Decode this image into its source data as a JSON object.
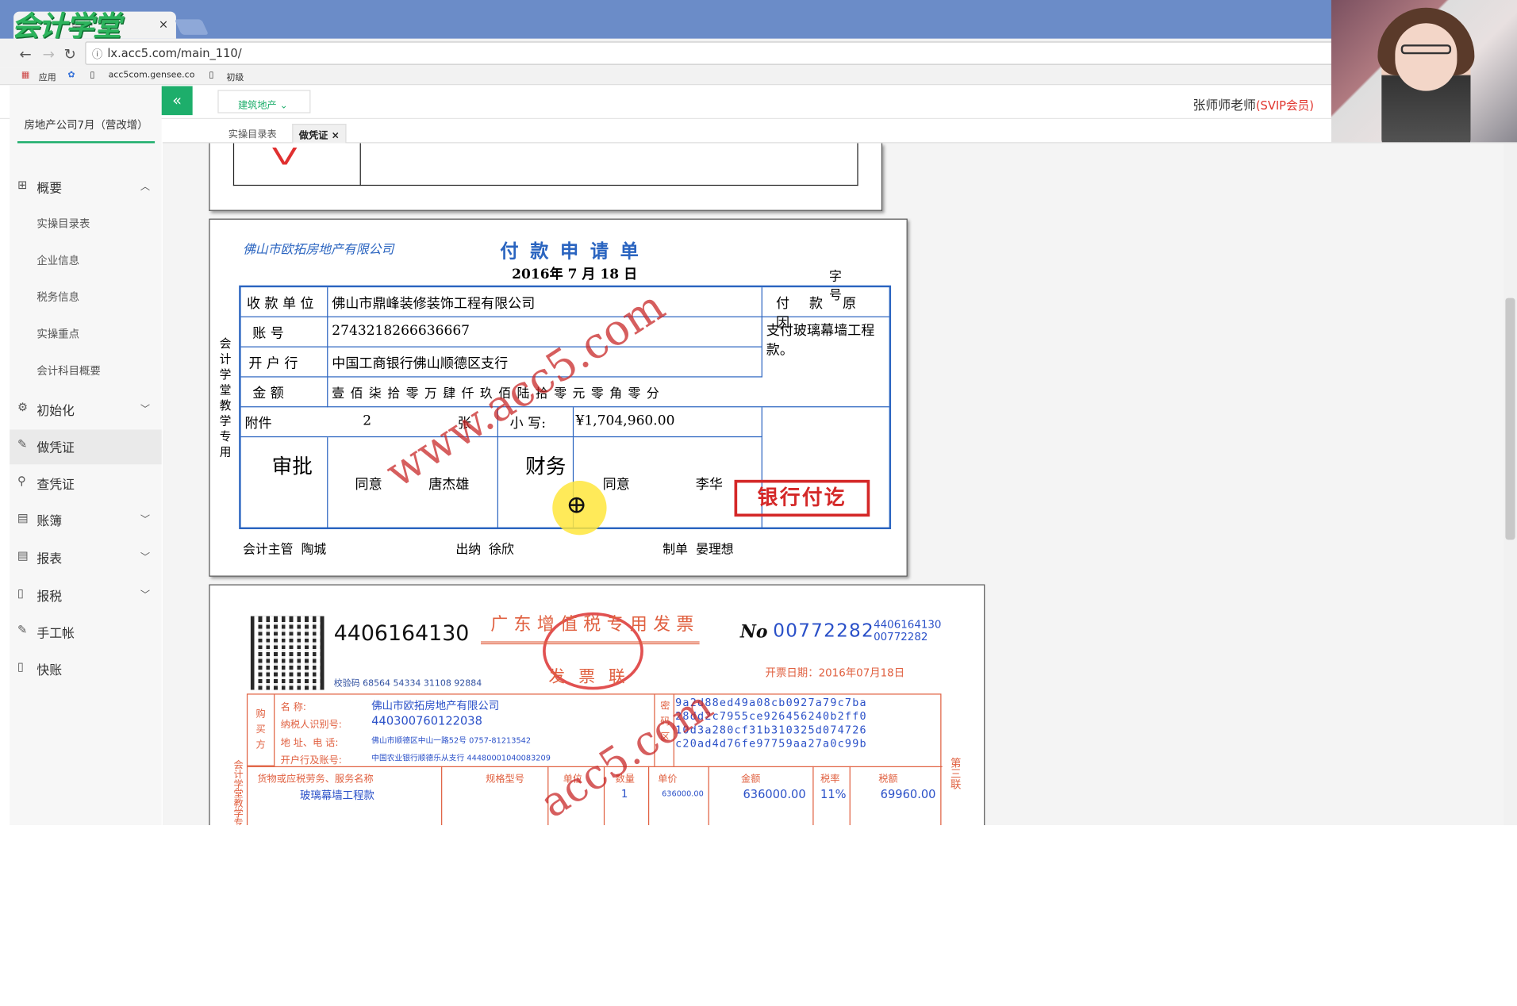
{
  "browser": {
    "tab_title": "会计 ×",
    "tab_title_short": "会计",
    "url": "lx.acc5.com/main_110/",
    "bookmarks": [
      "应用",
      "acc5com.gensee.co",
      "初级"
    ],
    "logo": "会计学堂"
  },
  "header": {
    "dropdown": "建筑地产",
    "user_name": "张师师老师",
    "user_badge": "(SVIP会员)",
    "tabs": [
      "实操目录表",
      "做凭证"
    ]
  },
  "sidebar": {
    "company": "房地产公司7月（营改增）",
    "sections": [
      {
        "label": "概要",
        "icon": "grid-icon",
        "expanded": true,
        "items": [
          "实操目录表",
          "企业信息",
          "税务信息",
          "实操重点",
          "会计科目概要"
        ]
      },
      {
        "label": "初始化",
        "icon": "gear-icon"
      },
      {
        "label": "做凭证",
        "icon": "pen-icon",
        "active": true
      },
      {
        "label": "查凭证",
        "icon": "search-icon"
      },
      {
        "label": "账簿",
        "icon": "book-icon"
      },
      {
        "label": "报表",
        "icon": "report-icon"
      },
      {
        "label": "报税",
        "icon": "file-icon"
      },
      {
        "label": "手工帐",
        "icon": "pen-icon"
      },
      {
        "label": "快账",
        "icon": "file-icon"
      }
    ]
  },
  "payment": {
    "company": "佛山市欧拓房地产有限公司",
    "title": "付款申请单",
    "date": "2016年 7 月 18 日",
    "number_label": "字 号",
    "side_text": "会计学堂教学专用",
    "payee_label": "收 款 单 位",
    "payee": "佛山市鼎峰装修装饰工程有限公司",
    "account_label": "账 号",
    "account": "2743218266636667",
    "bank_label": "开 户 行",
    "bank": "中国工商银行佛山顺德区支行",
    "amount_label": "金 额",
    "amount_words": "壹 佰 柒 拾 零 万 肆 仟 玖 佰 陆 拾 零 元 零 角 零 分",
    "attach_label": "附件",
    "attach_count": "2",
    "attach_unit": "张",
    "small_label": "小 写:",
    "small_value": "¥1,704,960.00",
    "reason_label": "付 款 原 因",
    "reason": "支付玻璃幕墙工程款。",
    "approve_label": "审批",
    "approve_opinion": "同意",
    "approve_person": "唐杰雄",
    "finance_label": "财务",
    "finance_opinion": "同意",
    "finance_person": "李华",
    "stamp": "银行付讫",
    "supervisor_label": "会计主管",
    "supervisor": "陶城",
    "cashier_label": "出纳",
    "cashier": "徐欣",
    "maker_label": "制单",
    "maker": "晏理想",
    "watermark": "www.acc5.com"
  },
  "invoice": {
    "code": "4406164130",
    "title": "广东增值税专用发票",
    "subtitle": "发票联",
    "no_label": "No",
    "number": "00772282",
    "small_code": "4406164130",
    "small_number": "00772282",
    "check_code": "校验码 68564 54334 31108 92884",
    "date_label": "开票日期：",
    "date": "2016年07月18日",
    "buyer_section": "购买方",
    "name_label": "名 称:",
    "name": "佛山市欧拓房地产有限公司",
    "tax_label": "纳税人识别号:",
    "tax_id": "440300760122038",
    "addr_label": "地 址、电 话:",
    "addr": "佛山市顺德区中山一路52号 0757-81213542",
    "bank_label": "开户行及账号:",
    "bank": "中国农业银行顺德乐从支行 44480001040083209",
    "pwd_section": "密码区",
    "cipher": [
      "9a2d88ed49a08cb0927a79c7ba",
      "28dd2c7955ce926456240b2ff0",
      "10d3a280cf31b310325d074726",
      "c20ad4d76fe97759aa27a0c99b"
    ],
    "col_headers": [
      "货物或应税劳务、服务名称",
      "规格型号",
      "单位",
      "数量",
      "单价",
      "金额",
      "税率",
      "税额"
    ],
    "item_name": "玻璃幕墙工程款",
    "qty": "1",
    "unit_price": "636000.00",
    "amount": "636000.00",
    "rate": "11%",
    "tax": "69960.00",
    "right_side": "第三联",
    "watermark": "acc5.com"
  }
}
